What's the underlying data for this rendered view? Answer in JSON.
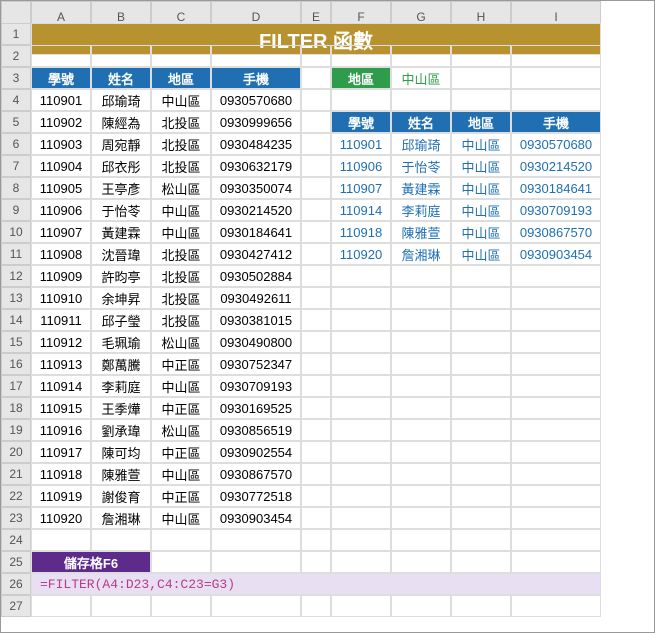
{
  "cols": [
    "A",
    "B",
    "C",
    "D",
    "E",
    "F",
    "G",
    "H",
    "I"
  ],
  "title": "FILTER 函數",
  "headers": {
    "id": "學號",
    "name": "姓名",
    "region": "地區",
    "phone": "手機"
  },
  "filter_label": "地區",
  "filter_value": "中山區",
  "rows": [
    {
      "id": "110901",
      "name": "邱瑜琦",
      "region": "中山區",
      "phone": "0930570680"
    },
    {
      "id": "110902",
      "name": "陳經為",
      "region": "北投區",
      "phone": "0930999656"
    },
    {
      "id": "110903",
      "name": "周宛靜",
      "region": "北投區",
      "phone": "0930484235"
    },
    {
      "id": "110904",
      "name": "邱衣彤",
      "region": "北投區",
      "phone": "0930632179"
    },
    {
      "id": "110905",
      "name": "王亭彥",
      "region": "松山區",
      "phone": "0930350074"
    },
    {
      "id": "110906",
      "name": "于怡苓",
      "region": "中山區",
      "phone": "0930214520"
    },
    {
      "id": "110907",
      "name": "黃建霖",
      "region": "中山區",
      "phone": "0930184641"
    },
    {
      "id": "110908",
      "name": "沈晉瑋",
      "region": "北投區",
      "phone": "0930427412"
    },
    {
      "id": "110909",
      "name": "許昀亭",
      "region": "北投區",
      "phone": "0930502884"
    },
    {
      "id": "110910",
      "name": "余坤昇",
      "region": "北投區",
      "phone": "0930492611"
    },
    {
      "id": "110911",
      "name": "邱子瑩",
      "region": "北投區",
      "phone": "0930381015"
    },
    {
      "id": "110912",
      "name": "毛珮瑜",
      "region": "松山區",
      "phone": "0930490800"
    },
    {
      "id": "110913",
      "name": "鄭萬騰",
      "region": "中正區",
      "phone": "0930752347"
    },
    {
      "id": "110914",
      "name": "李莉庭",
      "region": "中山區",
      "phone": "0930709193"
    },
    {
      "id": "110915",
      "name": "王季燁",
      "region": "中正區",
      "phone": "0930169525"
    },
    {
      "id": "110916",
      "name": "劉承瑋",
      "region": "松山區",
      "phone": "0930856519"
    },
    {
      "id": "110917",
      "name": "陳可均",
      "region": "中正區",
      "phone": "0930902554"
    },
    {
      "id": "110918",
      "name": "陳雅萱",
      "region": "中山區",
      "phone": "0930867570"
    },
    {
      "id": "110919",
      "name": "謝俊育",
      "region": "中正區",
      "phone": "0930772518"
    },
    {
      "id": "110920",
      "name": "詹湘琳",
      "region": "中山區",
      "phone": "0930903454"
    }
  ],
  "filtered": [
    {
      "id": "110901",
      "name": "邱瑜琦",
      "region": "中山區",
      "phone": "0930570680"
    },
    {
      "id": "110906",
      "name": "于怡苓",
      "region": "中山區",
      "phone": "0930214520"
    },
    {
      "id": "110907",
      "name": "黃建霖",
      "region": "中山區",
      "phone": "0930184641"
    },
    {
      "id": "110914",
      "name": "李莉庭",
      "region": "中山區",
      "phone": "0930709193"
    },
    {
      "id": "110918",
      "name": "陳雅萱",
      "region": "中山區",
      "phone": "0930867570"
    },
    {
      "id": "110920",
      "name": "詹湘琳",
      "region": "中山區",
      "phone": "0930903454"
    }
  ],
  "cell_label": "儲存格F6",
  "formula": "=FILTER(A4:D23,C4:C23=G3)"
}
